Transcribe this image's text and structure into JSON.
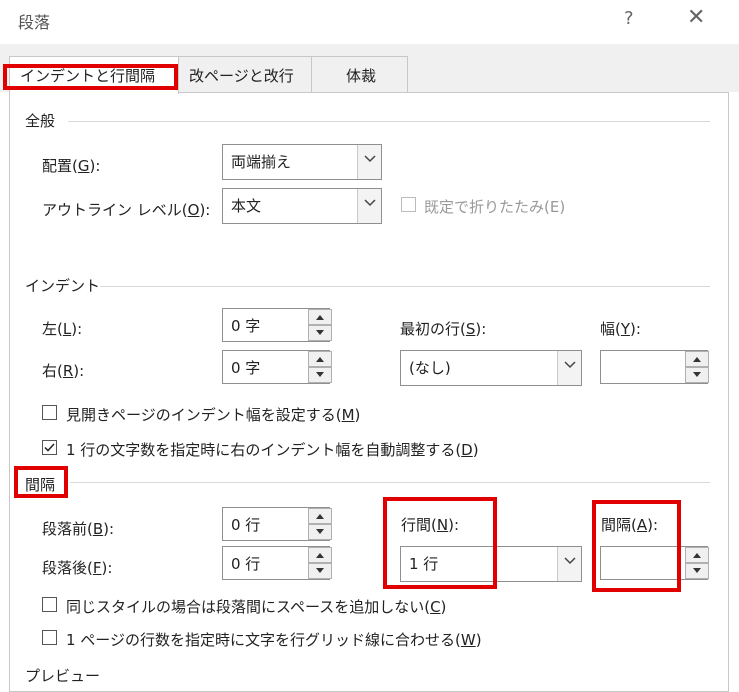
{
  "window": {
    "title": "段落",
    "help_label": "?",
    "close_label": "✕"
  },
  "tabs": [
    {
      "label": "インデントと行間隔",
      "active": true
    },
    {
      "label": "改ページと改行",
      "active": false
    },
    {
      "label": "体裁",
      "active": false
    }
  ],
  "general": {
    "heading": "全般",
    "alignment_label_pre": "配置(",
    "alignment_key": "G",
    "alignment_label_post": "):",
    "alignment_value": "両端揃え",
    "outline_label_pre": "アウトライン レベル(",
    "outline_key": "O",
    "outline_label_post": "):",
    "outline_value": "本文",
    "collapse_label": "既定で折りたたみ(E)"
  },
  "indent": {
    "heading": "インデント",
    "left_label_pre": "左(",
    "left_key": "L",
    "left_label_post": "):",
    "left_value": "0 字",
    "right_label_pre": "右(",
    "right_key": "R",
    "right_label_post": "):",
    "right_value": "0 字",
    "first_line_label_pre": "最初の行(",
    "first_line_key": "S",
    "first_line_label_post": "):",
    "first_line_value": "(なし)",
    "width_label_pre": "幅(",
    "width_key": "Y",
    "width_label_post": "):",
    "width_value": "",
    "mirror_label_pre": "見開きページのインデント幅を設定する(",
    "mirror_key": "M",
    "mirror_label_post": ")",
    "mirror_checked": false,
    "auto_adjust_label_pre": "1 行の文字数を指定時に右のインデント幅を自動調整する(",
    "auto_adjust_key": "D",
    "auto_adjust_label_post": ")",
    "auto_adjust_checked": true
  },
  "spacing": {
    "heading": "間隔",
    "before_label_pre": "段落前(",
    "before_key": "B",
    "before_label_post": "):",
    "before_value": "0 行",
    "after_label_pre": "段落後(",
    "after_key": "F",
    "after_label_post": "):",
    "after_value": "0 行",
    "line_spacing_label_pre": "行間(",
    "line_spacing_key": "N",
    "line_spacing_label_post": "):",
    "line_spacing_value": "1 行",
    "at_label_pre": "間隔(",
    "at_key": "A",
    "at_label_post": "):",
    "at_value": "",
    "no_space_label_pre": "同じスタイルの場合は段落間にスペースを追加しない(",
    "no_space_key": "C",
    "no_space_label_post": ")",
    "no_space_checked": false,
    "snap_grid_label_pre": "1 ページの行数を指定時に文字を行グリッド線に合わせる(",
    "snap_grid_key": "W",
    "snap_grid_label_post": ")",
    "snap_grid_checked": false
  },
  "cutoff_heading": "プレビュー",
  "colors": {
    "highlight": "#e00000",
    "panel_border": "#c8c8c8",
    "tab_background": "#f0f0f0"
  }
}
